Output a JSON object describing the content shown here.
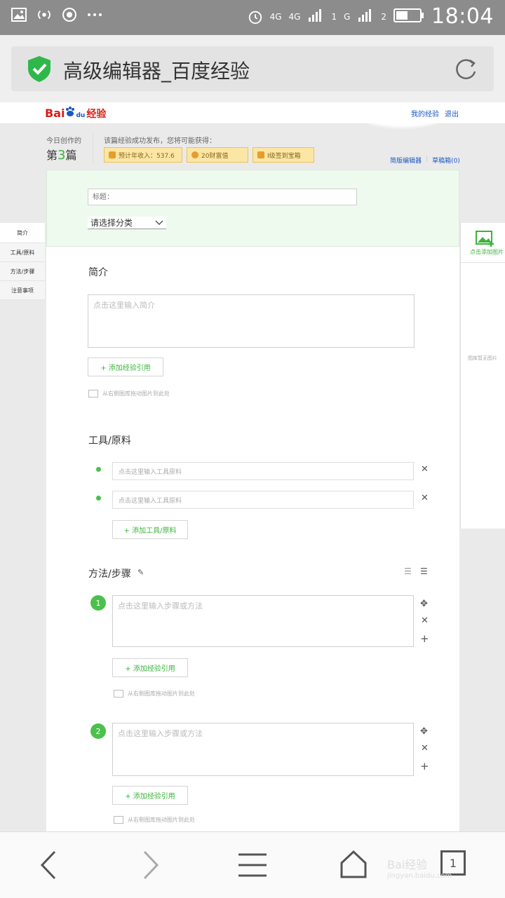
{
  "status_bar": {
    "time": "18:04",
    "net1": "4G",
    "net2": "4G",
    "sim1": "1",
    "net3": "G",
    "sim2": "2"
  },
  "browser": {
    "title": "高级编辑器_百度经验"
  },
  "web_header": {
    "logo_bai": "Bai",
    "logo_du": "du",
    "logo_jingyan": "经验",
    "link_my": "我的经验",
    "link_logout": "退出"
  },
  "today": {
    "label": "今日创作的",
    "prefix": "第",
    "count": "3",
    "suffix": "篇"
  },
  "publish": {
    "label": "该篇经验成功发布，您将可能获得：",
    "rewards": [
      "预计年收入：537.6",
      "20财富值",
      "I级签到宝箱"
    ]
  },
  "links_right": {
    "simple": "简版编辑器",
    "drafts": "草稿箱(0)"
  },
  "editor": {
    "title_placeholder": "标题：",
    "category": "请选择分类",
    "intro_title": "简介",
    "intro_placeholder": "点击这里输入简介",
    "add_ref": "+ 添加经验引用",
    "drag_hint": "从右侧图库拖动图片到此处",
    "tools_title": "工具/原料",
    "tool_placeholder": "点击这里输入工具原料",
    "add_tool": "+ 添加工具/原料",
    "steps_title": "方法/步骤",
    "step_placeholder": "点击这里输入步骤或方法",
    "step1": "1",
    "step2": "2"
  },
  "left_nav": [
    "简介",
    "工具/原料",
    "方法/步骤",
    "注意事项"
  ],
  "gallery": {
    "add": "点击添加图片",
    "empty": "图库暂无图片"
  },
  "watermark": {
    "line1": "Bai经验",
    "line2": "jingyan.baidu.com"
  },
  "bottom_nav": {
    "tab_count": "1"
  }
}
